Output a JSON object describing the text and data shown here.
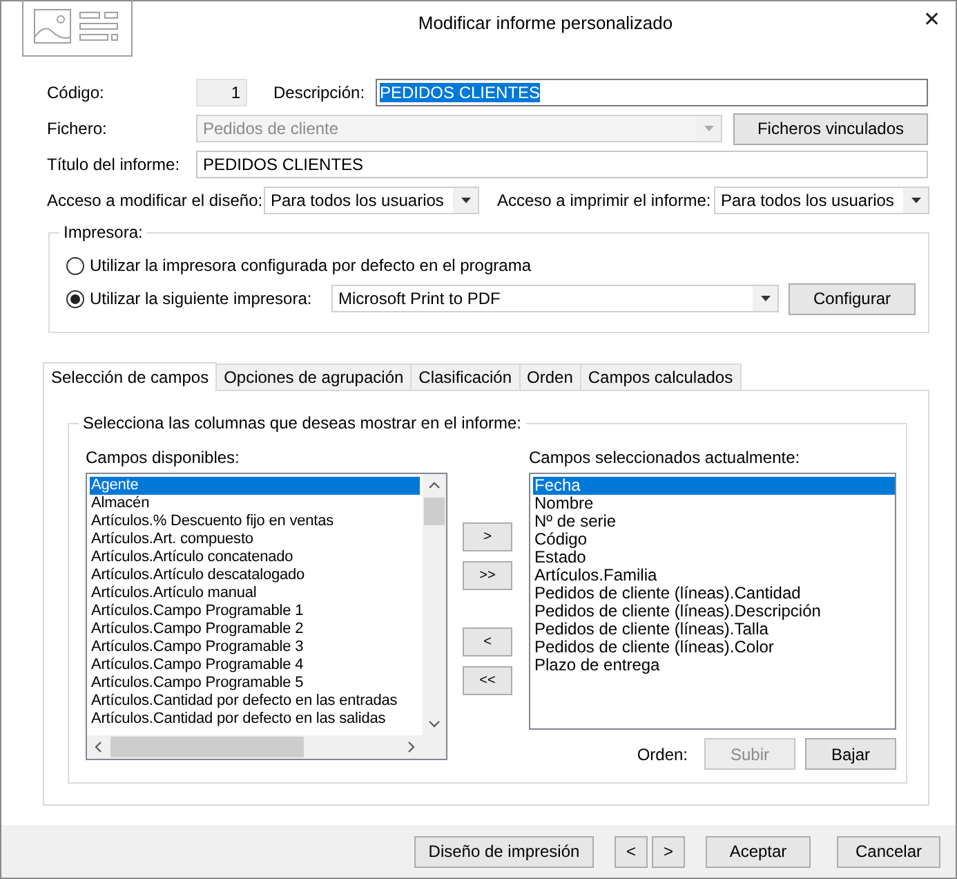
{
  "window": {
    "title": "Modificar informe personalizado",
    "close": "✕"
  },
  "form": {
    "codigo": {
      "label": "Código:",
      "value": "1"
    },
    "descripcion": {
      "label": "Descripción:",
      "value": "PEDIDOS CLIENTES",
      "text_selected": true
    },
    "fichero": {
      "label": "Fichero:",
      "value": "Pedidos de cliente",
      "disabled": true
    },
    "linked_files_button": "Ficheros vinculados",
    "titulo": {
      "label": "Título del informe:",
      "value": "PEDIDOS CLIENTES"
    },
    "acceso_modificar": {
      "label": "Acceso a modificar el diseño:",
      "value": "Para todos los usuarios"
    },
    "acceso_imprimir": {
      "label": "Acceso a imprimir el informe:",
      "value": "Para todos los usuarios"
    }
  },
  "printer": {
    "legend": "Impresora:",
    "options": [
      {
        "label": "Utilizar la impresora configurada por defecto en el programa",
        "selected": false
      },
      {
        "label": "Utilizar la siguiente impresora:",
        "selected": true
      }
    ],
    "printer_select": "Microsoft Print to PDF",
    "configure_button": "Configurar"
  },
  "tabs": [
    {
      "label": "Selección de campos",
      "selected": true
    },
    {
      "label": "Opciones de agrupación",
      "selected": false
    },
    {
      "label": "Clasificación",
      "selected": false
    },
    {
      "label": "Orden",
      "selected": false
    },
    {
      "label": "Campos calculados",
      "selected": false
    }
  ],
  "fields_panel": {
    "legend": "Selecciona las columnas que deseas mostrar en el informe:",
    "available": {
      "label": "Campos disponibles:",
      "items": [
        {
          "label": "Agente",
          "selected": true
        },
        {
          "label": "Almacén",
          "selected": false
        },
        {
          "label": "Artículos.% Descuento fijo en ventas",
          "selected": false
        },
        {
          "label": "Artículos.Art. compuesto",
          "selected": false
        },
        {
          "label": "Artículos.Artículo concatenado",
          "selected": false
        },
        {
          "label": "Artículos.Artículo descatalogado",
          "selected": false
        },
        {
          "label": "Artículos.Artículo manual",
          "selected": false
        },
        {
          "label": "Artículos.Campo Programable 1",
          "selected": false
        },
        {
          "label": "Artículos.Campo Programable 2",
          "selected": false
        },
        {
          "label": "Artículos.Campo Programable 3",
          "selected": false
        },
        {
          "label": "Artículos.Campo Programable 4",
          "selected": false
        },
        {
          "label": "Artículos.Campo Programable 5",
          "selected": false
        },
        {
          "label": "Artículos.Cantidad por defecto en las entradas",
          "selected": false
        },
        {
          "label": "Artículos.Cantidad por defecto en las salidas",
          "selected": false
        }
      ]
    },
    "move_buttons": [
      ">",
      ">>",
      "<",
      "<<"
    ],
    "selected_fields": {
      "label": "Campos seleccionados actualmente:",
      "items": [
        {
          "label": "Fecha",
          "selected": true
        },
        {
          "label": "Nombre",
          "selected": false
        },
        {
          "label": "Nº de serie",
          "selected": false
        },
        {
          "label": "Código",
          "selected": false
        },
        {
          "label": "Estado",
          "selected": false
        },
        {
          "label": "Artículos.Familia",
          "selected": false
        },
        {
          "label": "Pedidos de cliente (líneas).Cantidad",
          "selected": false
        },
        {
          "label": "Pedidos de cliente (líneas).Descripción",
          "selected": false
        },
        {
          "label": "Pedidos de cliente (líneas).Talla",
          "selected": false
        },
        {
          "label": "Pedidos de cliente (líneas).Color",
          "selected": false
        },
        {
          "label": "Plazo de entrega",
          "selected": false
        }
      ]
    },
    "order_label": "Orden:",
    "order_buttons": [
      {
        "label": "Subir",
        "disabled": true
      },
      {
        "label": "Bajar",
        "disabled": false
      }
    ]
  },
  "footer": {
    "design_button": "Diseño de impresión",
    "nav_buttons": [
      "<",
      ">"
    ],
    "accept_button": "Aceptar",
    "cancel_button": "Cancelar"
  }
}
